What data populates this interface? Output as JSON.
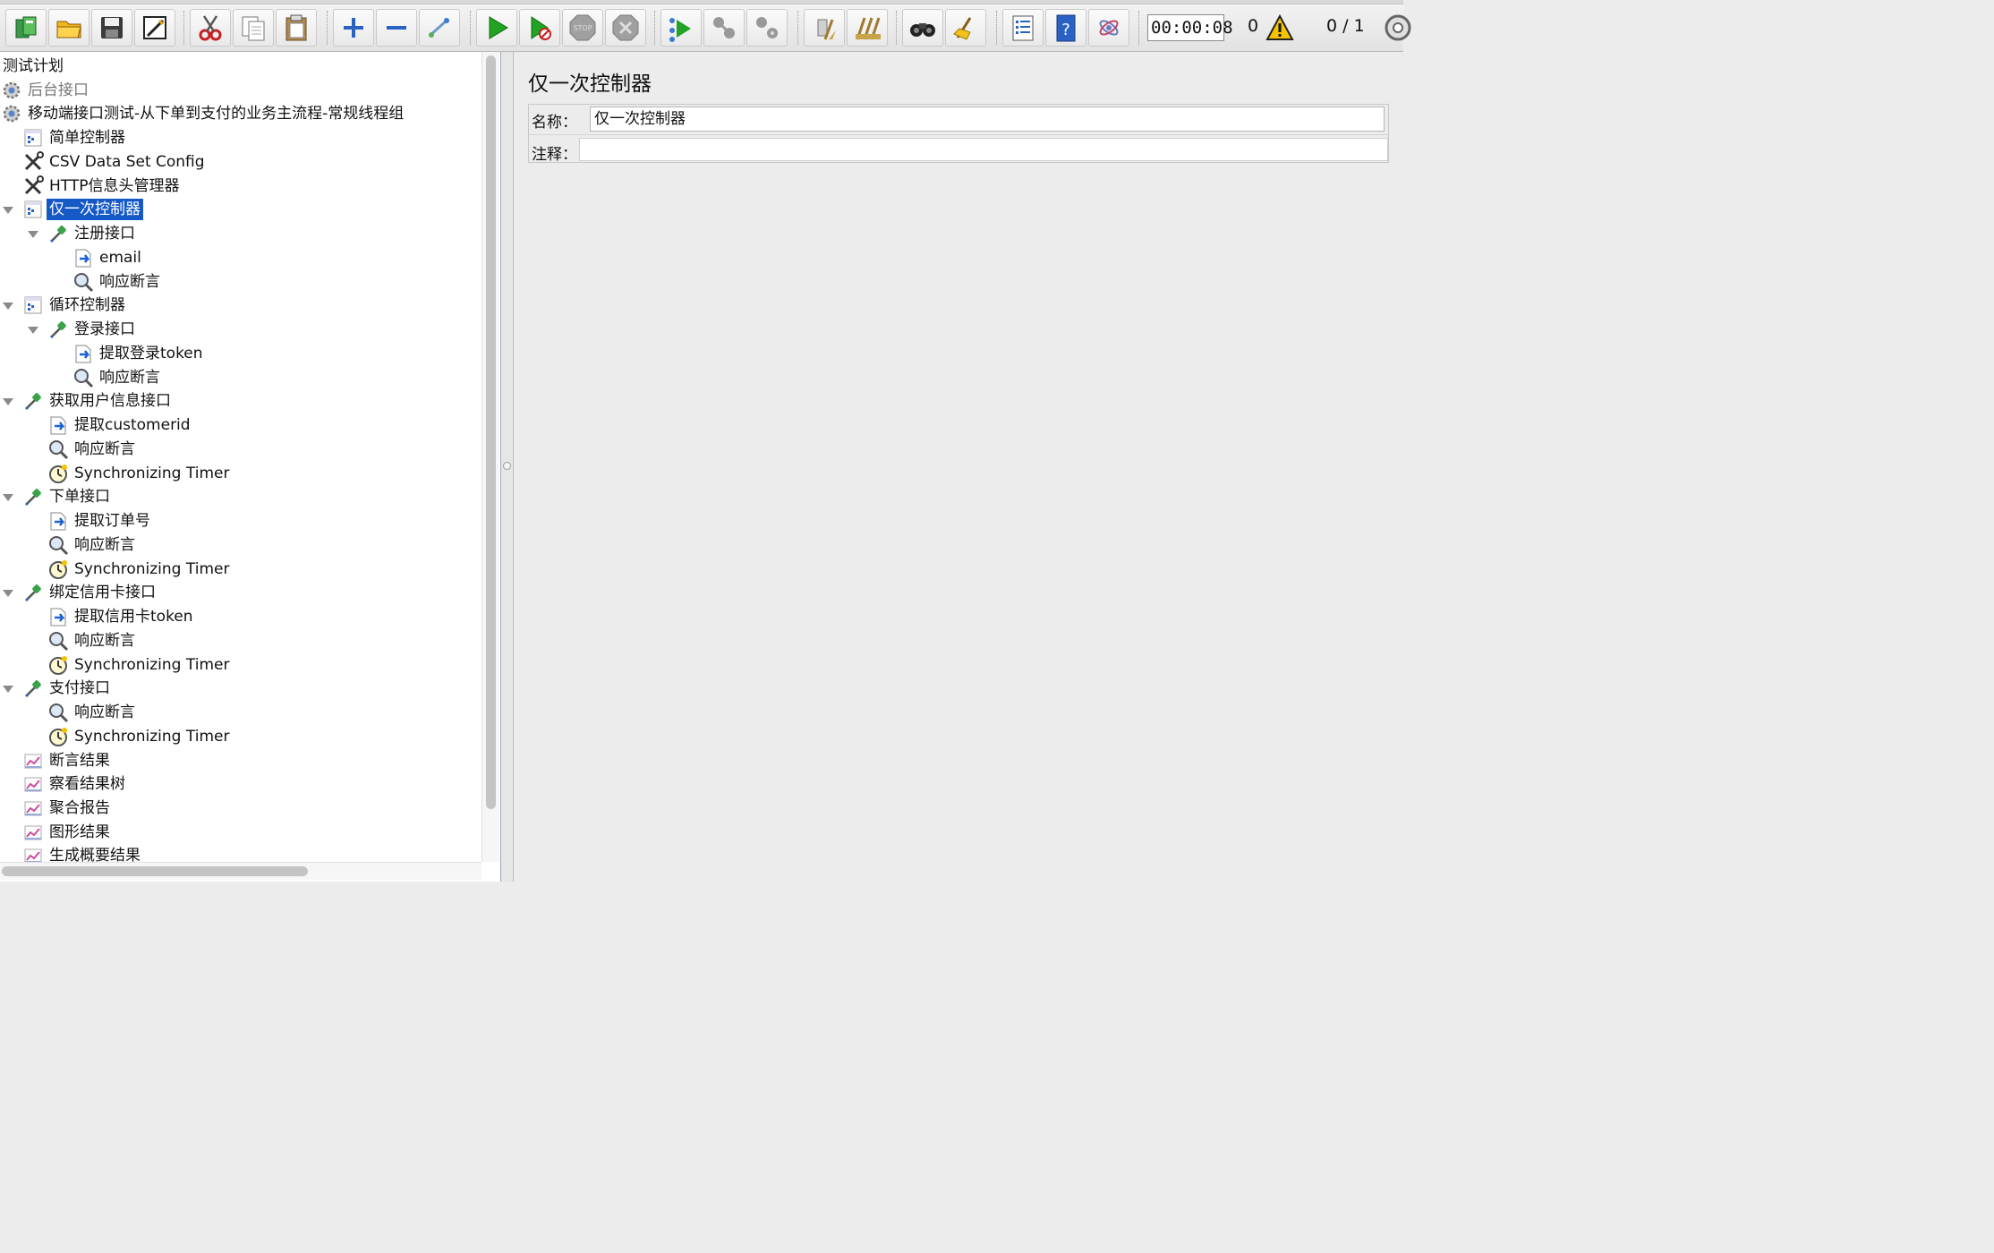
{
  "toolbar": {
    "buttons": [
      {
        "name": "templates-icon",
        "color": "#2f8a3a"
      },
      {
        "name": "open-icon",
        "color": "#e8a416"
      },
      {
        "name": "save-icon",
        "color": "#333333"
      },
      {
        "name": "save-as-icon",
        "color": "#333333"
      },
      {
        "name": "cut-icon",
        "color": "#c62020"
      },
      {
        "name": "copy-icon",
        "color": "#666666"
      },
      {
        "name": "paste-icon",
        "color": "#8a6a3a"
      },
      {
        "name": "expand-icon",
        "color": "#2a62c4"
      },
      {
        "name": "collapse-icon",
        "color": "#2a62c4"
      },
      {
        "name": "toggle-icon",
        "color": "#7aa0c8"
      },
      {
        "name": "start-icon",
        "color": "#22a324"
      },
      {
        "name": "start-no-pause-icon",
        "color": "#22a324"
      },
      {
        "name": "stop-icon",
        "color": "#9a9a9a"
      },
      {
        "name": "shutdown-icon",
        "color": "#9a9a9a"
      },
      {
        "name": "remote-start-icon",
        "color": "#22a324"
      },
      {
        "name": "remote-stop-icon",
        "color": "#999999"
      },
      {
        "name": "remote-shutdown-icon",
        "color": "#999999"
      },
      {
        "name": "clear-icon",
        "color": "#b08a40"
      },
      {
        "name": "clear-all-icon",
        "color": "#b08a40"
      },
      {
        "name": "search-icon",
        "color": "#222222"
      },
      {
        "name": "reset-search-icon",
        "color": "#e8b020"
      },
      {
        "name": "function-helper-icon",
        "color": "#2a62c4"
      },
      {
        "name": "help-icon",
        "color": "#2a62c4"
      },
      {
        "name": "log-viewer-icon",
        "color": "#6a7ac0"
      }
    ],
    "elapsed_time": "00:00:08",
    "error_count": "0",
    "threads": "0 / 1"
  },
  "tree": {
    "items": [
      {
        "label": "测试计划",
        "icon": "none",
        "level": 0,
        "toggle": ""
      },
      {
        "label": "后台接口",
        "icon": "thread-group-icon",
        "level": 0,
        "toggle": "",
        "disabled": true
      },
      {
        "label": "移动端接口测试-从下单到支付的业务主流程-常规线程组",
        "icon": "thread-group-icon",
        "level": 0,
        "toggle": ""
      },
      {
        "label": "简单控制器",
        "icon": "controller-icon",
        "level": 1,
        "toggle": ""
      },
      {
        "label": "CSV Data Set Config",
        "icon": "config-icon",
        "level": 1,
        "toggle": ""
      },
      {
        "label": "HTTP信息头管理器",
        "icon": "config-icon",
        "level": 1,
        "toggle": ""
      },
      {
        "label": "仅一次控制器",
        "icon": "controller-icon",
        "level": 1,
        "toggle": "open",
        "selected": true
      },
      {
        "label": "注册接口",
        "icon": "sampler-icon",
        "level": 2,
        "toggle": "open"
      },
      {
        "label": "email",
        "icon": "extractor-icon",
        "level": 3,
        "toggle": ""
      },
      {
        "label": "响应断言",
        "icon": "assertion-icon",
        "level": 3,
        "toggle": ""
      },
      {
        "label": "循环控制器",
        "icon": "controller-icon",
        "level": 1,
        "toggle": "open"
      },
      {
        "label": "登录接口",
        "icon": "sampler-icon",
        "level": 2,
        "toggle": "open"
      },
      {
        "label": "提取登录token",
        "icon": "extractor-icon",
        "level": 3,
        "toggle": ""
      },
      {
        "label": "响应断言",
        "icon": "assertion-icon",
        "level": 3,
        "toggle": ""
      },
      {
        "label": "获取用户信息接口",
        "icon": "sampler-icon",
        "level": 1,
        "toggle": "open"
      },
      {
        "label": "提取customerid",
        "icon": "extractor-icon",
        "level": 2,
        "toggle": ""
      },
      {
        "label": "响应断言",
        "icon": "assertion-icon",
        "level": 2,
        "toggle": ""
      },
      {
        "label": "Synchronizing Timer",
        "icon": "timer-icon",
        "level": 2,
        "toggle": ""
      },
      {
        "label": "下单接口",
        "icon": "sampler-icon",
        "level": 1,
        "toggle": "open"
      },
      {
        "label": "提取订单号",
        "icon": "extractor-icon",
        "level": 2,
        "toggle": ""
      },
      {
        "label": "响应断言",
        "icon": "assertion-icon",
        "level": 2,
        "toggle": ""
      },
      {
        "label": "Synchronizing Timer",
        "icon": "timer-icon",
        "level": 2,
        "toggle": ""
      },
      {
        "label": "绑定信用卡接口",
        "icon": "sampler-icon",
        "level": 1,
        "toggle": "open"
      },
      {
        "label": "提取信用卡token",
        "icon": "extractor-icon",
        "level": 2,
        "toggle": ""
      },
      {
        "label": "响应断言",
        "icon": "assertion-icon",
        "level": 2,
        "toggle": ""
      },
      {
        "label": "Synchronizing Timer",
        "icon": "timer-icon",
        "level": 2,
        "toggle": ""
      },
      {
        "label": "支付接口",
        "icon": "sampler-icon",
        "level": 1,
        "toggle": "open"
      },
      {
        "label": "响应断言",
        "icon": "assertion-icon",
        "level": 2,
        "toggle": ""
      },
      {
        "label": "Synchronizing Timer",
        "icon": "timer-icon",
        "level": 2,
        "toggle": ""
      },
      {
        "label": "断言结果",
        "icon": "listener-icon",
        "level": 1,
        "toggle": ""
      },
      {
        "label": "察看结果树",
        "icon": "listener-icon",
        "level": 1,
        "toggle": ""
      },
      {
        "label": "聚合报告",
        "icon": "listener-icon",
        "level": 1,
        "toggle": ""
      },
      {
        "label": "图形结果",
        "icon": "listener-icon",
        "level": 1,
        "toggle": ""
      },
      {
        "label": "生成概要结果",
        "icon": "listener-icon",
        "level": 1,
        "toggle": ""
      }
    ]
  },
  "panel": {
    "title": "仅一次控制器",
    "name_label": "名称：",
    "name_value": "仅一次控制器",
    "comment_label": "注释：",
    "comment_value": ""
  },
  "colors": {
    "selection": "#1559c7",
    "start_green": "#22a324",
    "warning_yellow": "#f5c400"
  }
}
